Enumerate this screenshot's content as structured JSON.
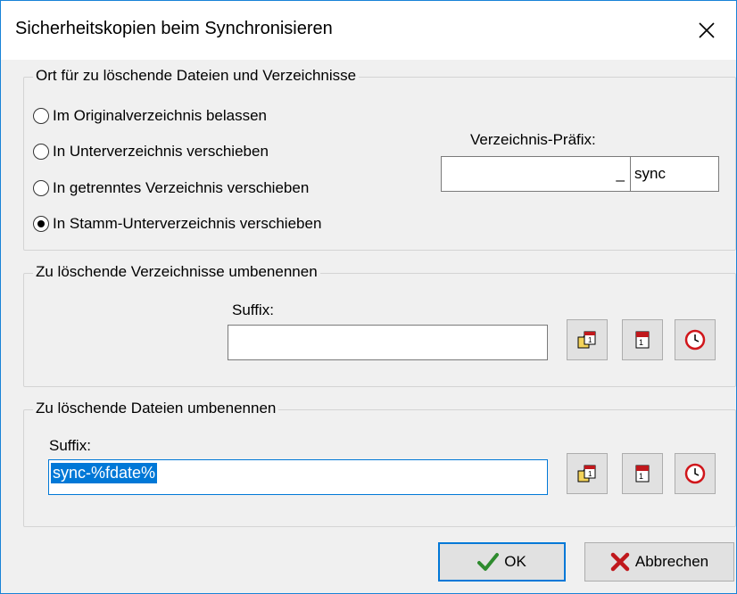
{
  "window": {
    "title": "Sicherheitskopien beim Synchronisieren",
    "close_icon": "close-icon"
  },
  "location_group": {
    "title": "Ort für zu löschende Dateien und Verzeichnisse",
    "options": [
      {
        "label": "Im Originalverzeichnis belassen",
        "checked": false
      },
      {
        "label": "In Unterverzeichnis verschieben",
        "checked": false
      },
      {
        "label": "In getrenntes Verzeichnis verschieben",
        "checked": false
      },
      {
        "label": "In Stamm-Unterverzeichnis verschieben",
        "checked": true
      }
    ],
    "prefix_label": "Verzeichnis-Präfix:",
    "prefix_value": "",
    "prefix_separator": "_",
    "prefix_suffix": "sync"
  },
  "dir_rename_group": {
    "title": "Zu löschende Verzeichnisse umbenennen",
    "suffix_label": "Suffix:",
    "suffix_value": ""
  },
  "file_rename_group": {
    "title": "Zu löschende Dateien umbenennen",
    "suffix_label": "Suffix:",
    "suffix_value": "sync-%fdate%"
  },
  "icons": [
    "folder-date-icon",
    "calendar-icon",
    "clock-icon"
  ],
  "buttons": {
    "ok": "OK",
    "cancel": "Abbrechen"
  },
  "colors": {
    "accent": "#0078d7",
    "ok_check": "#2e8b2e",
    "cancel_x": "#c0181c",
    "clock_red": "#d0161b"
  }
}
